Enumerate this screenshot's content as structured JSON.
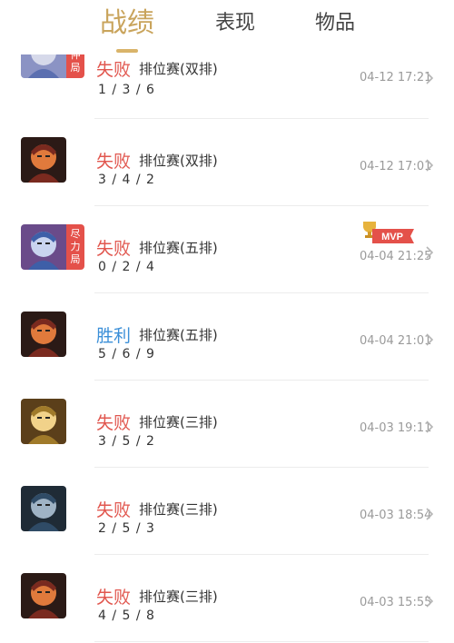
{
  "tabs": [
    {
      "label": "战绩",
      "active": true
    },
    {
      "label": "表现",
      "active": false
    },
    {
      "label": "物品",
      "active": false
    }
  ],
  "matches": [
    {
      "avatar_icon": "hero-portrait-icon",
      "badge": "伯仲局",
      "result": "失败",
      "win": false,
      "mode": "排位赛(双排)",
      "kda": "1 / 3 / 6",
      "time": "04-12 17:21",
      "mvp": false
    },
    {
      "avatar_icon": "hero-portrait-icon",
      "badge": null,
      "result": "失败",
      "win": false,
      "mode": "排位赛(双排)",
      "kda": "3 / 4 / 2",
      "time": "04-12 17:01",
      "mvp": false
    },
    {
      "avatar_icon": "hero-portrait-icon",
      "badge": "尽力局",
      "result": "失败",
      "win": false,
      "mode": "排位赛(五排)",
      "kda": "0 / 2 / 4",
      "time": "04-04 21:25",
      "mvp": true,
      "mvp_label": "MVP"
    },
    {
      "avatar_icon": "hero-portrait-icon",
      "badge": null,
      "result": "胜利",
      "win": true,
      "mode": "排位赛(五排)",
      "kda": "5 / 6 / 9",
      "time": "04-04 21:01",
      "mvp": false
    },
    {
      "avatar_icon": "hero-portrait-icon",
      "badge": null,
      "result": "失败",
      "win": false,
      "mode": "排位赛(三排)",
      "kda": "3 / 5 / 2",
      "time": "04-03 19:11",
      "mvp": false
    },
    {
      "avatar_icon": "hero-portrait-icon",
      "badge": null,
      "result": "失败",
      "win": false,
      "mode": "排位赛(三排)",
      "kda": "2 / 5 / 3",
      "time": "04-03 18:54",
      "mvp": false
    },
    {
      "avatar_icon": "hero-portrait-icon",
      "badge": null,
      "result": "失败",
      "win": false,
      "mode": "排位赛(三排)",
      "kda": "4 / 5 / 8",
      "time": "04-03 15:55",
      "mvp": false
    }
  ],
  "colors": {
    "accent": "#c9a45c",
    "lose": "#e1574f",
    "win": "#3b8fd8",
    "badge": "#e4514a"
  }
}
